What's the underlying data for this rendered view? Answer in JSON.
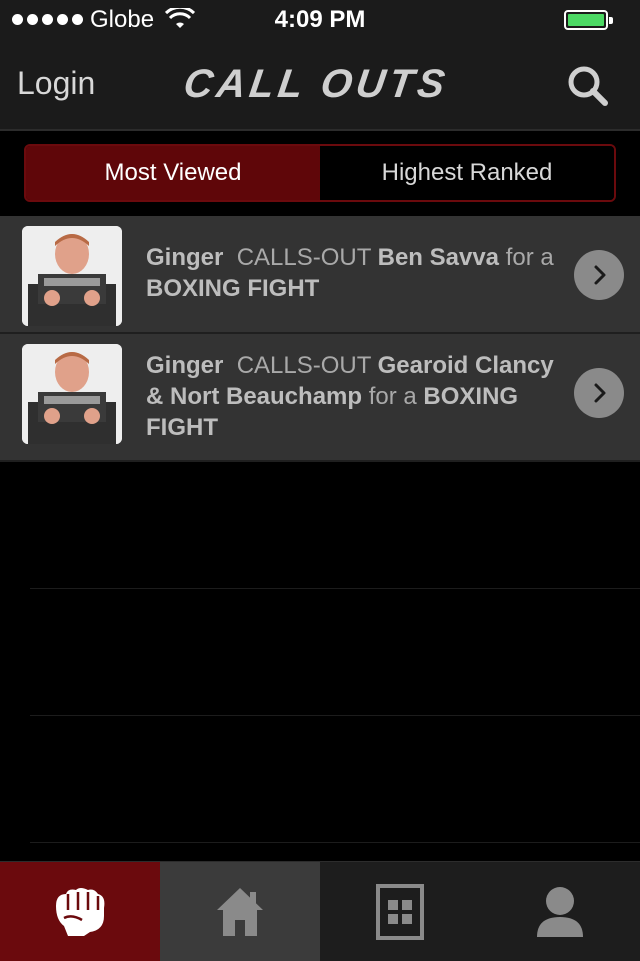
{
  "status_bar": {
    "carrier": "Globe",
    "time": "4:09 PM"
  },
  "nav": {
    "login_label": "Login",
    "brand": "CALL OUTS"
  },
  "segments": [
    {
      "label": "Most Viewed",
      "selected": true
    },
    {
      "label": "Highest Ranked",
      "selected": false
    }
  ],
  "callouts": [
    {
      "challenger": "Ginger",
      "verb": "CALLS-OUT",
      "opponents": "Ben Savva",
      "connector": "for a",
      "fight_type": "BOXING FIGHT"
    },
    {
      "challenger": "Ginger",
      "verb": "CALLS-OUT",
      "opponents": "Gearoid Clancy & Nort Beauchamp",
      "connector": "for a",
      "fight_type": "BOXING FIGHT"
    }
  ],
  "tabs": [
    {
      "name": "fist-icon",
      "selected": true
    },
    {
      "name": "home-icon",
      "selected": false
    },
    {
      "name": "building-icon",
      "selected": false
    },
    {
      "name": "profile-icon",
      "selected": false
    }
  ],
  "colors": {
    "accent": "#6b0a0d",
    "row_bg": "#333333",
    "battery": "#4cd964"
  }
}
